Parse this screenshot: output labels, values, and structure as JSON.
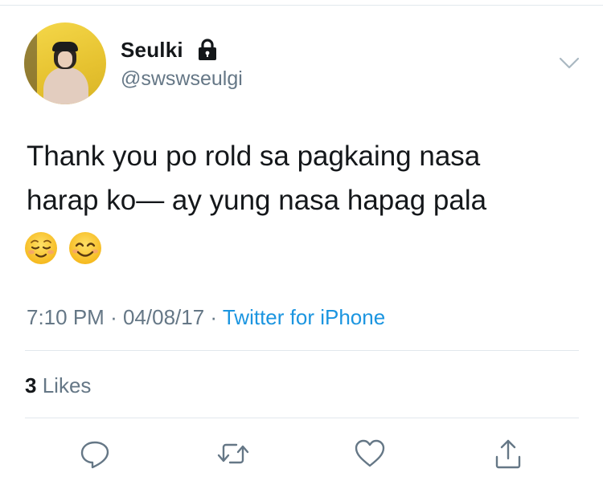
{
  "tweet": {
    "author": {
      "display_name": "Seulki",
      "handle": "@swswseulgi",
      "protected": true
    },
    "text_lines": [
      "Thank you po rold sa pagkaing nasa",
      "harap ko— ay yung nasa hapag pala"
    ],
    "emojis": [
      "☺️",
      "😊"
    ],
    "meta": {
      "time": "7:10 PM",
      "separator": "·",
      "date": "04/08/17",
      "source": "Twitter for iPhone"
    },
    "stats": {
      "likes_count": "3",
      "likes_label": "Likes"
    },
    "actions": [
      "reply-icon",
      "retweet-icon",
      "like-icon",
      "share-icon"
    ]
  },
  "colors": {
    "text": "#14171a",
    "secondary": "#657786",
    "link": "#1b95e0",
    "divider": "#e1e8ed"
  }
}
